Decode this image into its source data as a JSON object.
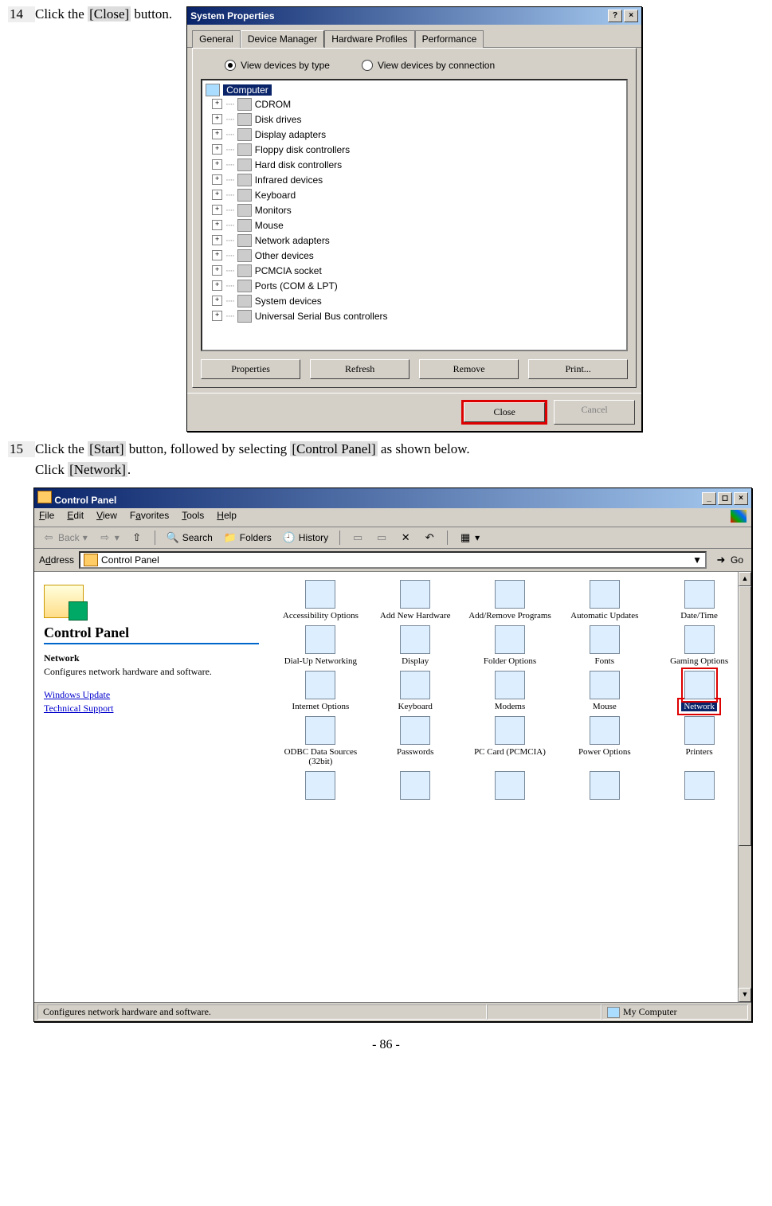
{
  "step14": {
    "num": "14",
    "text_a": "Click the ",
    "btn": "[Close]",
    "text_b": " button."
  },
  "step15": {
    "num": "15",
    "text_a": "Click the ",
    "btn1": "[Start]",
    "text_b": " button, followed by selecting ",
    "btn2": "[Control Panel]",
    "text_c": " as shown below.",
    "line2_a": "Click ",
    "btn3": "[Network]",
    "line2_b": "."
  },
  "sysprops": {
    "title": "System Properties",
    "tabs": [
      "General",
      "Device Manager",
      "Hardware Profiles",
      "Performance"
    ],
    "radio1": "View devices by type",
    "radio2": "View devices by connection",
    "root": "Computer",
    "items": [
      "CDROM",
      "Disk drives",
      "Display adapters",
      "Floppy disk controllers",
      "Hard disk controllers",
      "Infrared devices",
      "Keyboard",
      "Monitors",
      "Mouse",
      "Network adapters",
      "Other devices",
      "PCMCIA socket",
      "Ports (COM & LPT)",
      "System devices",
      "Universal Serial Bus controllers"
    ],
    "btns": {
      "properties": "Properties",
      "refresh": "Refresh",
      "remove": "Remove",
      "print": "Print..."
    },
    "close": "Close",
    "cancel": "Cancel",
    "help": "?",
    "x": "×"
  },
  "cp": {
    "title": "Control Panel",
    "min": "_",
    "max": "◻",
    "x": "×",
    "menu": [
      "File",
      "Edit",
      "View",
      "Favorites",
      "Tools",
      "Help"
    ],
    "tb": {
      "back": "Back",
      "search": "Search",
      "folders": "Folders",
      "history": "History"
    },
    "addr_label": "Address",
    "addr_value": "Control Panel",
    "go": "Go",
    "left": {
      "title": "Control Panel",
      "sel": "Network",
      "desc": "Configures network hardware and software.",
      "link1": "Windows Update",
      "link2": "Technical Support"
    },
    "items": [
      {
        "n": "Accessibility Options"
      },
      {
        "n": "Add New Hardware"
      },
      {
        "n": "Add/Remove Programs"
      },
      {
        "n": "Automatic Updates"
      },
      {
        "n": "Date/Time"
      },
      {
        "n": "Dial-Up Networking"
      },
      {
        "n": "Display"
      },
      {
        "n": "Folder Options"
      },
      {
        "n": "Fonts"
      },
      {
        "n": "Gaming Options"
      },
      {
        "n": "Internet Options"
      },
      {
        "n": "Keyboard"
      },
      {
        "n": "Modems"
      },
      {
        "n": "Mouse"
      },
      {
        "n": "Network",
        "sel": true
      },
      {
        "n": "ODBC Data Sources (32bit)"
      },
      {
        "n": "Passwords"
      },
      {
        "n": "PC Card (PCMCIA)"
      },
      {
        "n": "Power Options"
      },
      {
        "n": "Printers"
      },
      {
        "n": ""
      },
      {
        "n": ""
      },
      {
        "n": ""
      },
      {
        "n": ""
      },
      {
        "n": ""
      }
    ],
    "status": "Configures network hardware and software.",
    "status_right": "My Computer"
  },
  "pagenum": "- 86 -"
}
